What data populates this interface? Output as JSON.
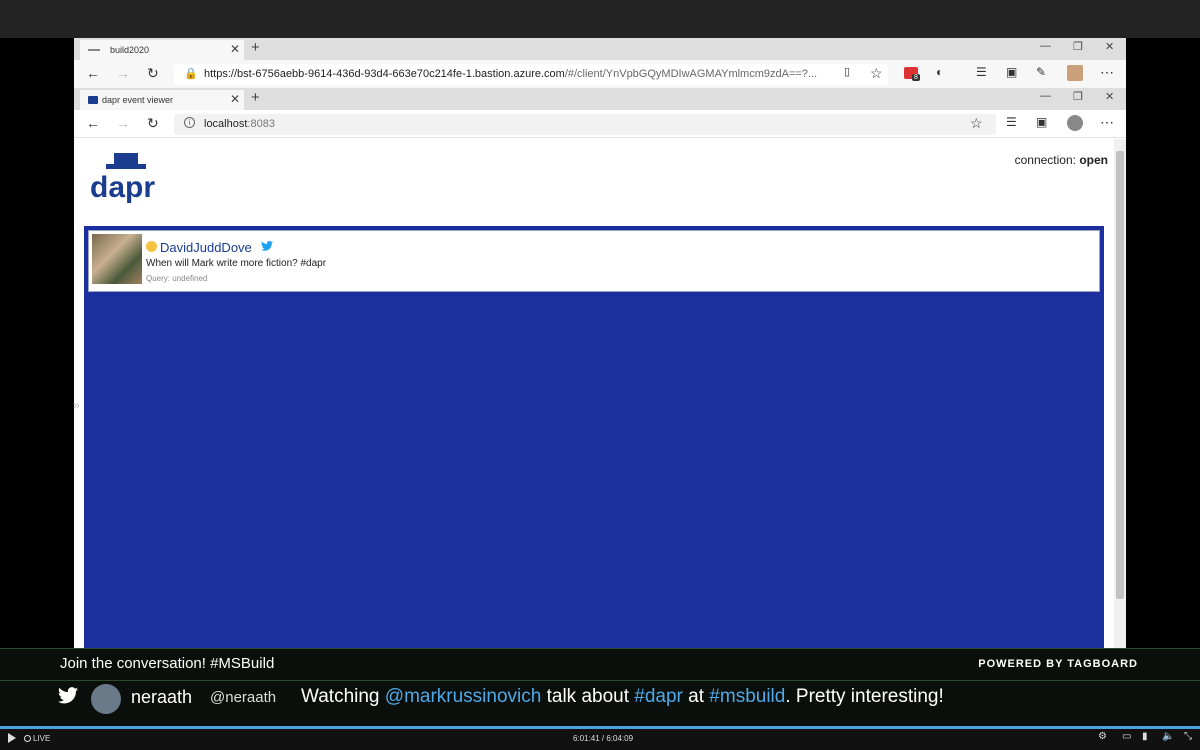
{
  "outer_browser": {
    "tab_title": "build2020",
    "url_host": "https://bst-6756aebb-9614-436d-93d4-663e70c214fe-1.bastion.azure.com",
    "url_rest": "/#/client/YnVpbGQyMDIwAGMAYmlmcm9zdA==?...",
    "badge_count": "8"
  },
  "inner_browser": {
    "tab_title": "dapr event viewer",
    "url_host": "localhost",
    "url_port": ":8083"
  },
  "page": {
    "logo_text": "dapr",
    "connection_label": "connection:",
    "connection_status": "open",
    "tweet": {
      "username": "DavidJuddDove",
      "text": "When will Mark write more fiction? #dapr",
      "query": "Query: undefined"
    }
  },
  "overlay": {
    "join_text": "Join the conversation! #MSBuild",
    "powered_by": "POWERED BY TAGBOARD",
    "post": {
      "name": "neraath",
      "handle": "@neraath",
      "text_1": "Watching ",
      "mention": "@markrussinovich",
      "text_2": " talk about ",
      "tag_1": "#dapr",
      "text_3": " at ",
      "tag_2": "#msbuild",
      "text_4": ". Pretty interesting!"
    }
  },
  "player": {
    "live_label": "LIVE",
    "time": "6:01:41 / 6:04:09"
  },
  "colors": {
    "dapr_blue": "#1c2f9e",
    "link_blue": "#4fa9e8",
    "twitter_blue": "#1da1f2"
  }
}
